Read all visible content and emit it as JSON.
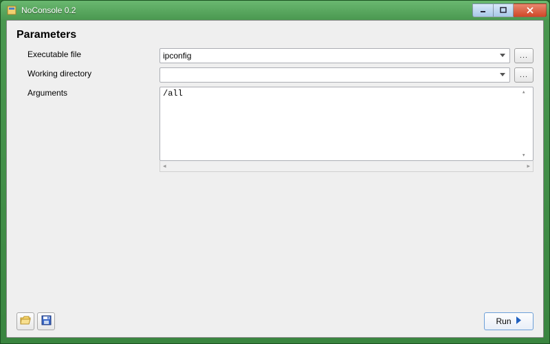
{
  "window": {
    "title": "NoConsole 0.2"
  },
  "section": {
    "header": "Parameters"
  },
  "form": {
    "executable": {
      "label": "Executable file",
      "value": "ipconfig",
      "browse": "..."
    },
    "workdir": {
      "label": "Working directory",
      "value": "",
      "browse": "..."
    },
    "arguments": {
      "label": "Arguments",
      "value": "/all"
    }
  },
  "buttons": {
    "run": "Run"
  },
  "icons": {
    "app": "app-icon",
    "open": "folder-open-icon",
    "save": "floppy-icon",
    "play": "play-icon"
  }
}
